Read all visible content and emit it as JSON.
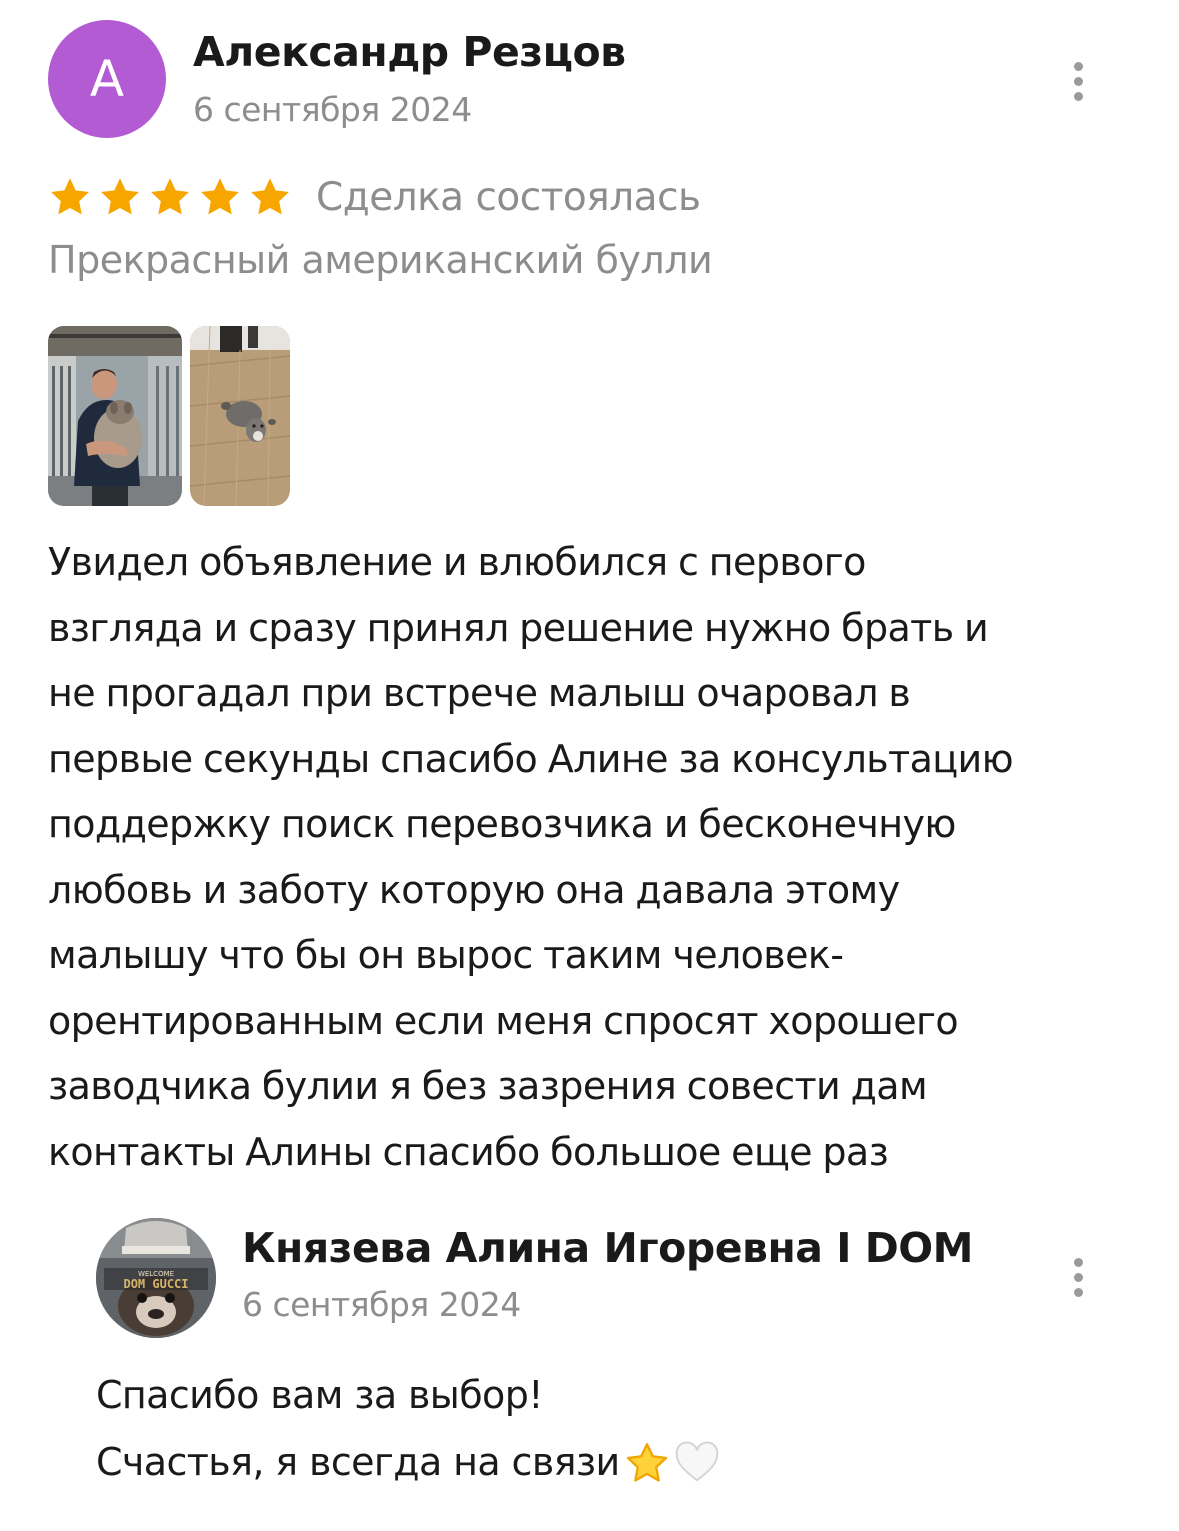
{
  "review": {
    "author": {
      "initial": "A",
      "name": "Александр Резцов",
      "avatar_color": "#b25bd2"
    },
    "date": "6 сентября 2024",
    "rating": 5,
    "star_color": "#f7a600",
    "deal_status": "Сделка состоялась",
    "item_title": "Прекрасный американский булли",
    "photos": [
      "photo-man-holding-puppy",
      "photo-puppy-on-floor"
    ],
    "text_lines": [
      "Увидел объявление и влюбился с первого",
      "взгляда и сразу принял решение нужно брать и",
      "не прогадал при встрече малыш очаровал в",
      "первые секунды спасибо Алине за консультацию",
      "поддержку поиск перевозчика и бесконечную",
      "любовь и заботу которую она давала этому",
      "малышу что бы он вырос  таким человек-",
      "орентированным если меня спросят хорошего",
      "заводчика булии я без зазрения совести дам",
      "контакты Алины спасибо большое еще раз"
    ]
  },
  "reply": {
    "author": {
      "name": "Князева Алина Игоревна I DOM",
      "avatar_text_top": "WELCOME",
      "avatar_text_main": "DOM GUCCI"
    },
    "date": "6 сентября 2024",
    "text_lines": [
      "Спасибо вам за выбор!",
      "Счастья, я всегда на связи"
    ],
    "emojis": [
      "star-emoji",
      "white-heart-emoji"
    ]
  },
  "icons": {
    "more": "more-vertical-icon",
    "star": "star-icon"
  }
}
